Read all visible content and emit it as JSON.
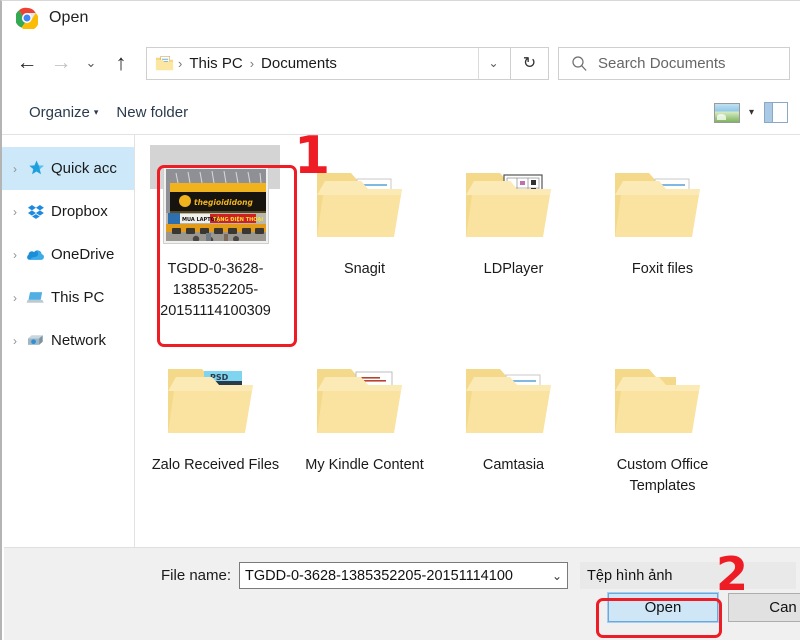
{
  "window": {
    "title": "Open",
    "app_icon": "chrome-icon"
  },
  "nav": {
    "back": "←",
    "forward": "→",
    "history": "⌄",
    "up": "↑",
    "refresh": "↻",
    "dropdown": "⌄"
  },
  "breadcrumb": {
    "icon": "documents-folder-icon",
    "items": [
      "This PC",
      "Documents"
    ],
    "separator": "›"
  },
  "search": {
    "placeholder": "Search Documents",
    "icon": "search-icon"
  },
  "toolbar": {
    "organize_label": "Organize",
    "organize_caret": "▾",
    "new_folder_label": "New folder",
    "view_icon": "large-icons-view-icon",
    "view_caret": "▾",
    "preview_pane_icon": "preview-pane-icon"
  },
  "sidebar": {
    "items": [
      {
        "label": "Quick acc",
        "icon": "star-icon",
        "chevron": "›",
        "active": true
      },
      {
        "label": "Dropbox",
        "icon": "dropbox-icon",
        "chevron": "›",
        "active": false
      },
      {
        "label": "OneDrive",
        "icon": "onedrive-cloud-icon",
        "chevron": "›",
        "active": false
      },
      {
        "label": "This PC",
        "icon": "computer-icon",
        "chevron": "›",
        "active": false
      },
      {
        "label": "Network",
        "icon": "network-icon",
        "chevron": "›",
        "active": false
      }
    ]
  },
  "files": {
    "items": [
      {
        "name": "TGDD-0-3628-1385352205-20151114100309",
        "type": "image",
        "icon": "image-thumbnail",
        "selected": true,
        "thumbnail_text": "thegioididong",
        "thumbnail_banner": "MUA LAPTOP  TẶNG ĐIỆN THOẠI"
      },
      {
        "name": "Snagit",
        "type": "folder",
        "icon": "folder-icon",
        "selected": false
      },
      {
        "name": "LDPlayer",
        "type": "folder",
        "icon": "folder-icon",
        "selected": false
      },
      {
        "name": "Foxit files",
        "type": "folder",
        "icon": "folder-icon",
        "selected": false
      },
      {
        "name": "Zalo Received Files",
        "type": "folder",
        "icon": "folder-icon",
        "selected": false
      },
      {
        "name": "My Kindle Content",
        "type": "folder",
        "icon": "folder-icon",
        "selected": false
      },
      {
        "name": "Camtasia",
        "type": "folder",
        "icon": "folder-icon",
        "selected": false
      },
      {
        "name": "Custom Office Templates",
        "type": "folder",
        "icon": "folder-icon",
        "selected": false
      }
    ]
  },
  "footer": {
    "file_name_label": "File name:",
    "file_name_value": "TGDD-0-3628-1385352205-20151114100",
    "file_name_caret": "⌄",
    "file_type_value": "Tệp hình ảnh",
    "open_button": "Open",
    "cancel_button": "Can"
  },
  "annotations": {
    "step1": "1",
    "step2": "2",
    "color": "#ee1c25"
  }
}
